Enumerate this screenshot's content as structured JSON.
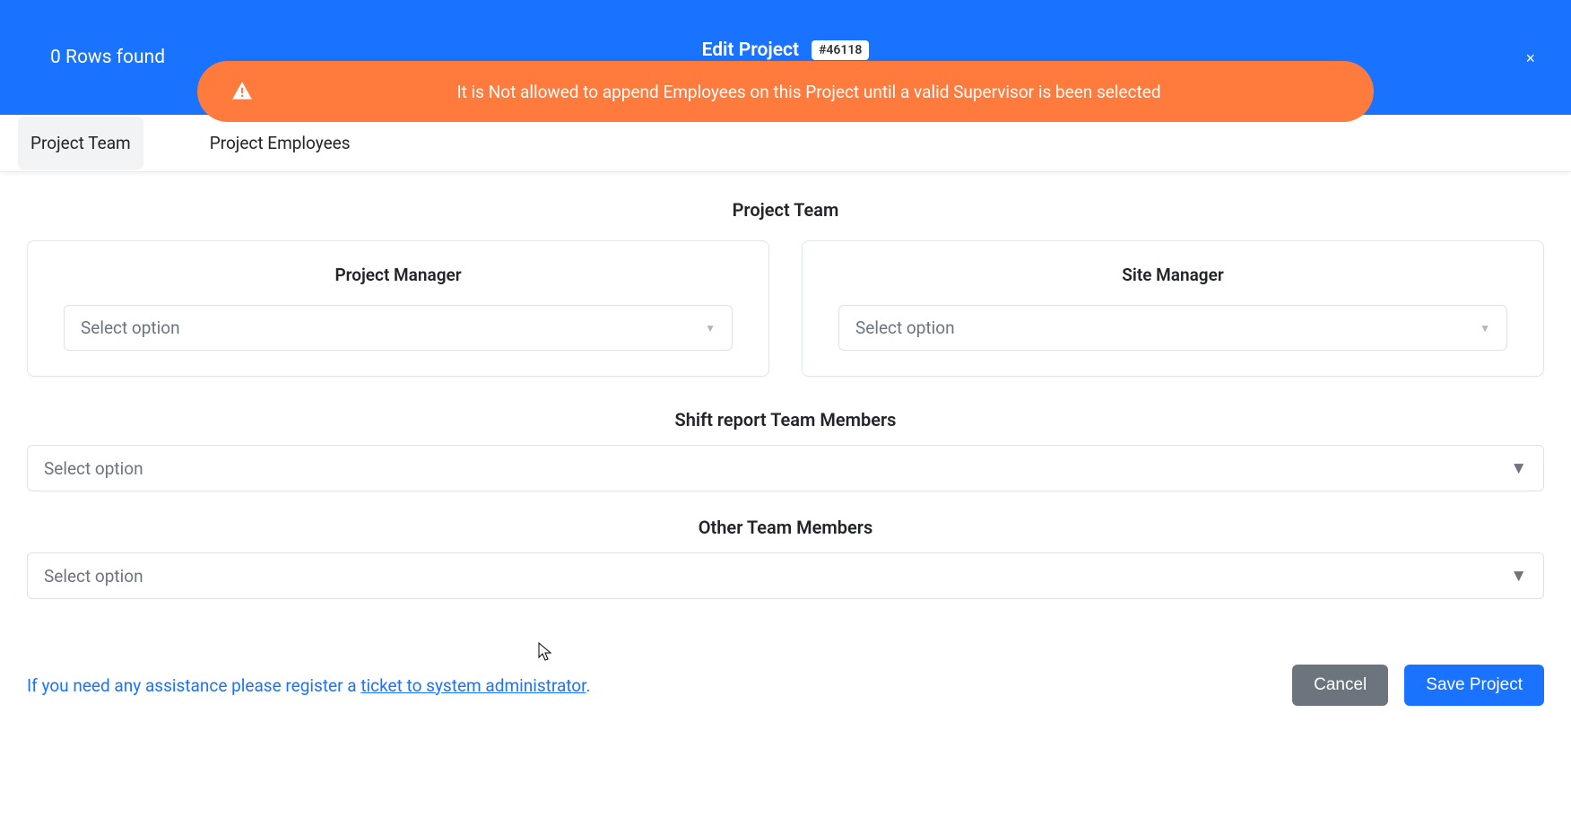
{
  "header": {
    "rows_found_label": "0 Rows found",
    "title": "Edit Project",
    "project_badge": "#46118",
    "close_label": "×"
  },
  "alert": {
    "message": "It is Not allowed to append Employees on this Project until a valid Supervisor is been selected"
  },
  "tabs": [
    {
      "label": "Project Team",
      "active": true
    },
    {
      "label": "Project Employees",
      "active": false
    }
  ],
  "sections": {
    "project_team_title": "Project Team",
    "project_manager_label": "Project Manager",
    "site_manager_label": "Site Manager",
    "shift_report_title": "Shift report Team Members",
    "other_team_title": "Other Team Members",
    "select_placeholder": "Select option"
  },
  "footer": {
    "help_prefix": "If you need any assistance please register a ",
    "help_link_text": "ticket to system administrator",
    "help_suffix": ".",
    "cancel_label": "Cancel",
    "save_label": "Save Project"
  }
}
